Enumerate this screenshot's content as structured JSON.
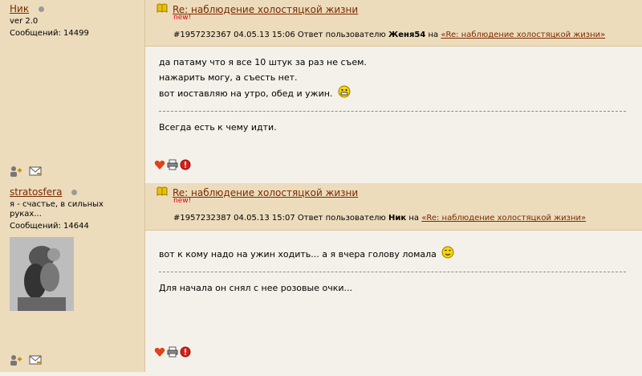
{
  "posts": [
    {
      "author": "Ник",
      "status": "ver 2.0",
      "messages": "Сообщений: 14499",
      "title": "Re: наблюдение холостяцкой жизни",
      "new_label": "new!",
      "meta_prefix": "#1957232367 04.05.13 15:06 Ответ пользователю",
      "reply_to": "Женя54",
      "meta_on": "на",
      "meta_link": "«Re: наблюдение холостяцкой жизни»",
      "lines": [
        "да патаму что я все 10 штук за раз не съем.",
        "нажарить могу, а съесть нет.",
        "вот иоставляю на утро, обед и ужин."
      ],
      "signature": "Всегда есть к чему идти."
    },
    {
      "author": "stratosfera",
      "status": "я - счастье, в сильных руках...",
      "messages": "Сообщений: 14644",
      "title": "Re: наблюдение холостяцкой жизни",
      "new_label": "new!",
      "meta_prefix": "#1957232387 04.05.13 15:07 Ответ пользователю",
      "reply_to": "Ник",
      "meta_on": "на",
      "meta_link": "«Re: наблюдение холостяцкой жизни»",
      "lines": [
        "вот к кому надо на ужин ходить... а я вчера голову ломала"
      ],
      "signature": "Для начала он снял с нее розовые очки..."
    }
  ],
  "icons": {
    "title": "open-book-icon",
    "profile": "user-add-icon",
    "mail": "envelope-icon",
    "like": "heart-icon",
    "print": "printer-icon",
    "report": "warning-icon",
    "emoji1": "grin-smiley-icon",
    "emoji2": "smile-smiley-icon"
  }
}
